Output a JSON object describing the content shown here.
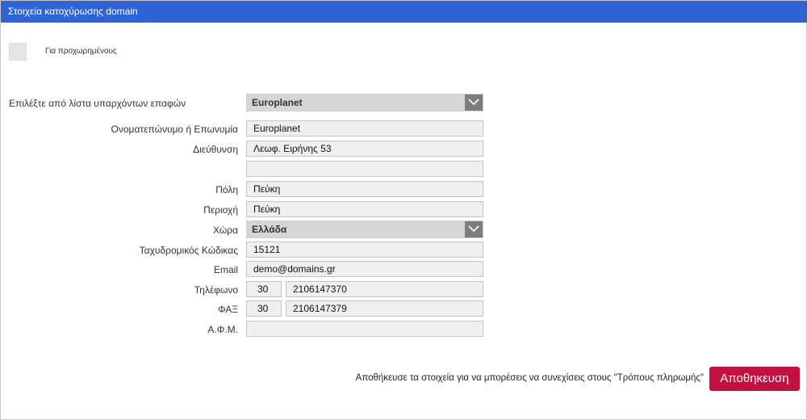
{
  "header": {
    "title": "Στοιχεία κατοχύρωσης domain"
  },
  "advanced": {
    "label": "Για προχωρημένους"
  },
  "contact_select": {
    "label": "Επιλέξτε από λίστα υπαρχόντων επαφών",
    "value": "Europlanet",
    "icon": "chevron-down-icon"
  },
  "form": {
    "name": {
      "label": "Ονοματεπώνυμο ή Επωνυμία",
      "value": "Europlanet"
    },
    "address": {
      "label": "Διεύθυνση",
      "value": "Λεωφ. Ειρήνης 53",
      "value2": ""
    },
    "city": {
      "label": "Πόλη",
      "value": "Πεύκη"
    },
    "region": {
      "label": "Περιοχή",
      "value": "Πεύκη"
    },
    "country": {
      "label": "Χώρα",
      "value": "Ελλάδα",
      "icon": "chevron-down-icon"
    },
    "postal": {
      "label": "Ταχυδρομικός Κώδικας",
      "value": "15121"
    },
    "email": {
      "label": "Email",
      "value": "demo@domains.gr"
    },
    "phone": {
      "label": "Τηλέφωνο",
      "code": "30",
      "number": "2106147370"
    },
    "fax": {
      "label": "ΦΑΞ",
      "code": "30",
      "number": "2106147379"
    },
    "vat": {
      "label": "Α.Φ.Μ.",
      "value": ""
    }
  },
  "footer": {
    "hint": "Αποθήκευσε τα στοιχεία για να μπορέσεις να συνεχίσεις στους \"Τρόπους πληρωμής\"",
    "save_label": "Αποθηκευση"
  },
  "colors": {
    "header": "#2f64d6",
    "save_button": "#c2103f"
  }
}
